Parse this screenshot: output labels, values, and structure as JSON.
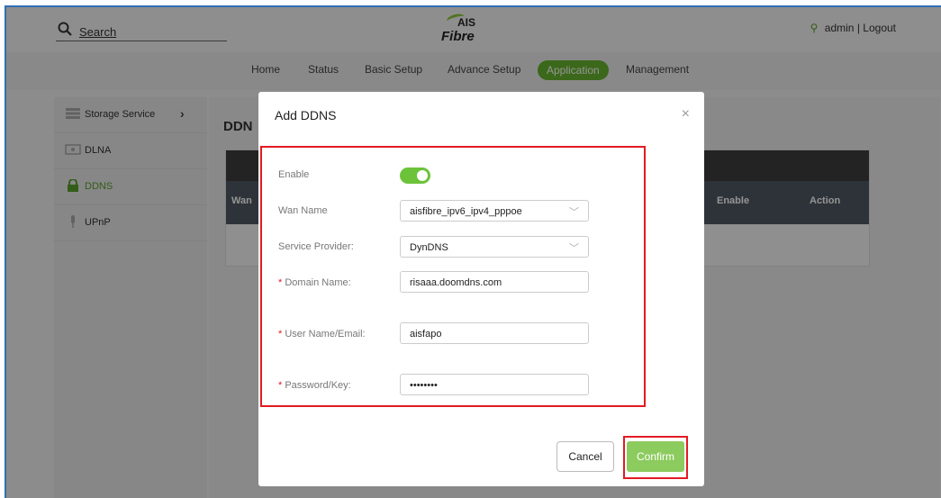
{
  "header": {
    "search_placeholder": "Search",
    "logo_top": "AIS",
    "logo_bottom": "Fibre",
    "user": "admin",
    "separator": "|",
    "logout": "Logout"
  },
  "nav": {
    "items": [
      "Home",
      "Status",
      "Basic Setup",
      "Advance Setup",
      "Application",
      "Management"
    ],
    "active": "Application"
  },
  "sidebar": {
    "items": [
      {
        "label": "Storage Service",
        "icon": "storage-icon"
      },
      {
        "label": "DLNA",
        "icon": "dlna-icon"
      },
      {
        "label": "DDNS",
        "icon": "lock-icon",
        "selected": true
      },
      {
        "label": "UPnP",
        "icon": "upnp-icon"
      }
    ]
  },
  "main": {
    "title": "DDN",
    "columns": [
      "Wan",
      "Enable",
      "Action"
    ]
  },
  "modal": {
    "title": "Add DDNS",
    "close": "×",
    "fields": {
      "enable_label": "Enable",
      "enable_value": true,
      "wan_label": "Wan Name",
      "wan_value": "aisfibre_ipv6_ipv4_pppoe",
      "provider_label": "Service Provider:",
      "provider_value": "DynDNS",
      "domain_label": "Domain Name:",
      "domain_value": "risaaa.doomdns.com",
      "user_label": "User Name/Email:",
      "user_value": "aisfapo",
      "password_label": "Password/Key:",
      "password_value": "••••••••",
      "required_mark": "*",
      "dropdown_glyph": "﹀"
    },
    "cancel": "Cancel",
    "confirm": "Confirm"
  },
  "colors": {
    "accent": "#67b32e",
    "highlight": "#e21b23",
    "confirm": "#8ccb5e"
  }
}
